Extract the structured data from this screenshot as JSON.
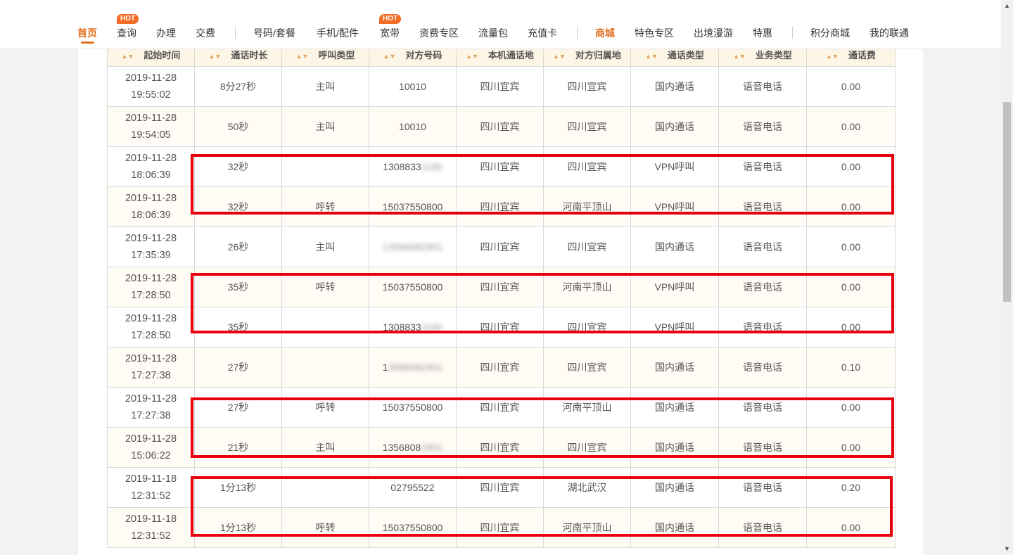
{
  "nav": {
    "items": [
      {
        "label": "首页"
      },
      {
        "label": "查询"
      },
      {
        "label": "办理"
      },
      {
        "label": "交费"
      },
      {
        "label": "号码/套餐"
      },
      {
        "label": "手机/配件"
      },
      {
        "label": "宽带"
      },
      {
        "label": "资费专区"
      },
      {
        "label": "流量包"
      },
      {
        "label": "充值卡"
      },
      {
        "label": "商城"
      },
      {
        "label": "特色专区"
      },
      {
        "label": "出境漫游"
      },
      {
        "label": "特惠"
      },
      {
        "label": "积分商城"
      },
      {
        "label": "我的联通"
      }
    ],
    "hot_badge": "HOT",
    "accent_color": "#e0701e"
  },
  "table": {
    "headers": [
      "起始时间",
      "通话时长",
      "呼叫类型",
      "对方号码",
      "本机通话地",
      "对方归属地",
      "通话类型",
      "业务类型",
      "通话费"
    ],
    "rows": [
      {
        "date": "2019-11-28",
        "time": "19:55:02",
        "duration": "8分27秒",
        "call_type": "主叫",
        "number": "10010",
        "number_blurred": "",
        "local": "四川宜宾",
        "remote": "四川宜宾",
        "comm_type": "国内通话",
        "biz_type": "语音电话",
        "fee": "0.00"
      },
      {
        "date": "2019-11-28",
        "time": "19:54:05",
        "duration": "50秒",
        "call_type": "主叫",
        "number": "10010",
        "number_blurred": "",
        "local": "四川宜宾",
        "remote": "四川宜宾",
        "comm_type": "国内通话",
        "biz_type": "语音电话",
        "fee": "0.00"
      },
      {
        "date": "2019-11-28",
        "time": "18:06:39",
        "duration": "32秒",
        "call_type": "",
        "number": "1308833",
        "number_blurred": "1180",
        "local": "四川宜宾",
        "remote": "四川宜宾",
        "comm_type": "VPN呼叫",
        "biz_type": "语音电话",
        "fee": "0.00"
      },
      {
        "date": "2019-11-28",
        "time": "18:06:39",
        "duration": "32秒",
        "call_type": "呼转",
        "number": "15037550800",
        "number_blurred": "",
        "local": "四川宜宾",
        "remote": "河南平顶山",
        "comm_type": "VPN呼叫",
        "biz_type": "语音电话",
        "fee": "0.00"
      },
      {
        "date": "2019-11-28",
        "time": "17:35:39",
        "duration": "26秒",
        "call_type": "主叫",
        "number": "",
        "number_blurred": "13568082901",
        "local": "四川宜宾",
        "remote": "四川宜宾",
        "comm_type": "国内通话",
        "biz_type": "语音电话",
        "fee": "0.00"
      },
      {
        "date": "2019-11-28",
        "time": "17:28:50",
        "duration": "35秒",
        "call_type": "呼转",
        "number": "15037550800",
        "number_blurred": "",
        "local": "四川宜宾",
        "remote": "河南平顶山",
        "comm_type": "VPN呼叫",
        "biz_type": "语音电话",
        "fee": "0.00"
      },
      {
        "date": "2019-11-28",
        "time": "17:28:50",
        "duration": "35秒",
        "call_type": "",
        "number": "1308833",
        "number_blurred": "1180",
        "local": "四川宜宾",
        "remote": "四川宜宾",
        "comm_type": "VPN呼叫",
        "biz_type": "语音电话",
        "fee": "0.00"
      },
      {
        "date": "2019-11-28",
        "time": "17:27:38",
        "duration": "27秒",
        "call_type": "",
        "number": "1",
        "number_blurred": "3568082901",
        "local": "四川宜宾",
        "remote": "四川宜宾",
        "comm_type": "国内通话",
        "biz_type": "语音电话",
        "fee": "0.10"
      },
      {
        "date": "2019-11-28",
        "time": "17:27:38",
        "duration": "27秒",
        "call_type": "呼转",
        "number": "15037550800",
        "number_blurred": "",
        "local": "四川宜宾",
        "remote": "河南平顶山",
        "comm_type": "国内通话",
        "biz_type": "语音电话",
        "fee": "0.00"
      },
      {
        "date": "2019-11-28",
        "time": "15:06:22",
        "duration": "21秒",
        "call_type": "主叫",
        "number": "1356808",
        "number_blurred": "2901",
        "local": "四川宜宾",
        "remote": "四川宜宾",
        "comm_type": "国内通话",
        "biz_type": "语音电话",
        "fee": "0.00"
      },
      {
        "date": "2019-11-18",
        "time": "12:31:52",
        "duration": "1分13秒",
        "call_type": "",
        "number": "02795522",
        "number_blurred": "",
        "local": "四川宜宾",
        "remote": "湖北武汉",
        "comm_type": "国内通话",
        "biz_type": "语音电话",
        "fee": "0.20"
      },
      {
        "date": "2019-11-18",
        "time": "12:31:52",
        "duration": "1分13秒",
        "call_type": "呼转",
        "number": "15037550800",
        "number_blurred": "",
        "local": "四川宜宾",
        "remote": "河南平顶山",
        "comm_type": "国内通话",
        "biz_type": "语音电话",
        "fee": "0.00"
      }
    ]
  },
  "highlight_color": "#e8000d"
}
